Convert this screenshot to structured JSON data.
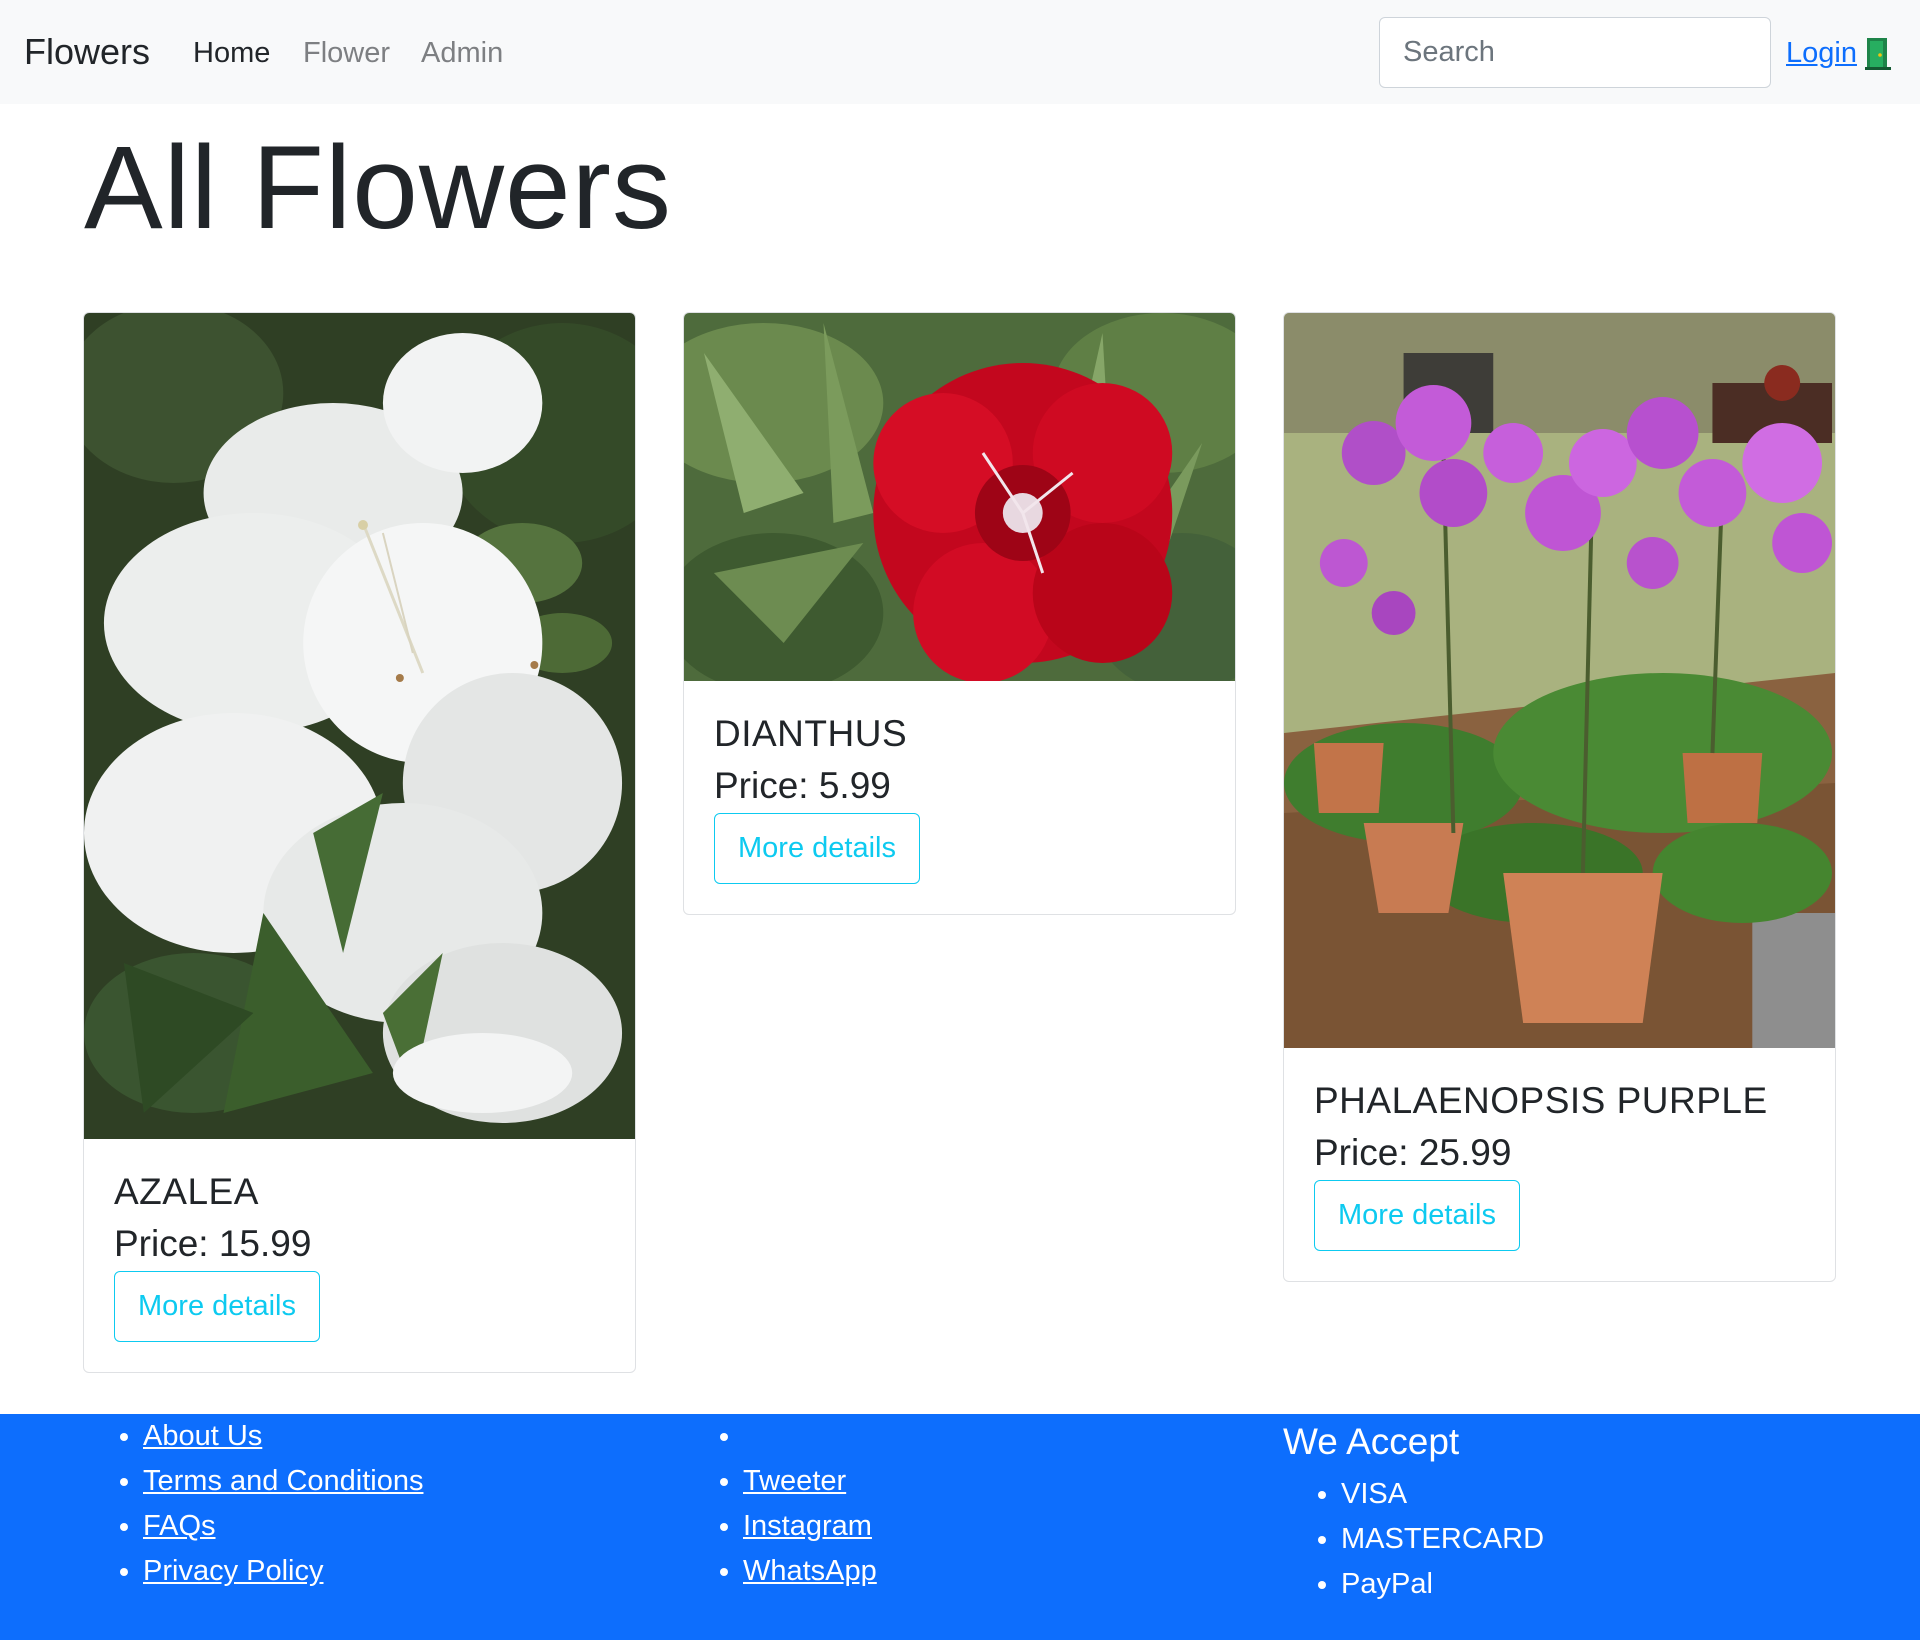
{
  "navbar": {
    "brand": "Flowers",
    "links": [
      {
        "label": "Home",
        "active": true
      },
      {
        "label": "Flower",
        "active": false
      },
      {
        "label": "Admin",
        "active": false
      }
    ],
    "search": {
      "placeholder": "Search",
      "value": ""
    },
    "login_label": "Login",
    "login_icon": "door-icon"
  },
  "page": {
    "title": "All Flowers"
  },
  "cards": [
    {
      "name": "AZALEA",
      "price": "Price: 15.99",
      "button": "More details",
      "image": "white-azalea-photo"
    },
    {
      "name": "DIANTHUS",
      "price": "Price: 5.99",
      "button": "More details",
      "image": "red-dianthus-photo"
    },
    {
      "name": "PHALAENOPSIS PURPLE",
      "price": "Price: 25.99",
      "button": "More details",
      "image": "purple-orchids-photo"
    }
  ],
  "footer": {
    "links_col1": [
      "About Us",
      "Terms and Conditions",
      "FAQs",
      "Privacy Policy"
    ],
    "links_col2": [
      "",
      "Tweeter",
      "Instagram",
      "WhatsApp"
    ],
    "accept_title": "We Accept",
    "payments": [
      "VISA",
      "MASTERCARD",
      "PayPal"
    ]
  },
  "colors": {
    "navbar_bg": "#f8f9fa",
    "footer_bg": "#0d6efd",
    "button_accent": "#0dcaf0",
    "link": "#0d6efd"
  }
}
